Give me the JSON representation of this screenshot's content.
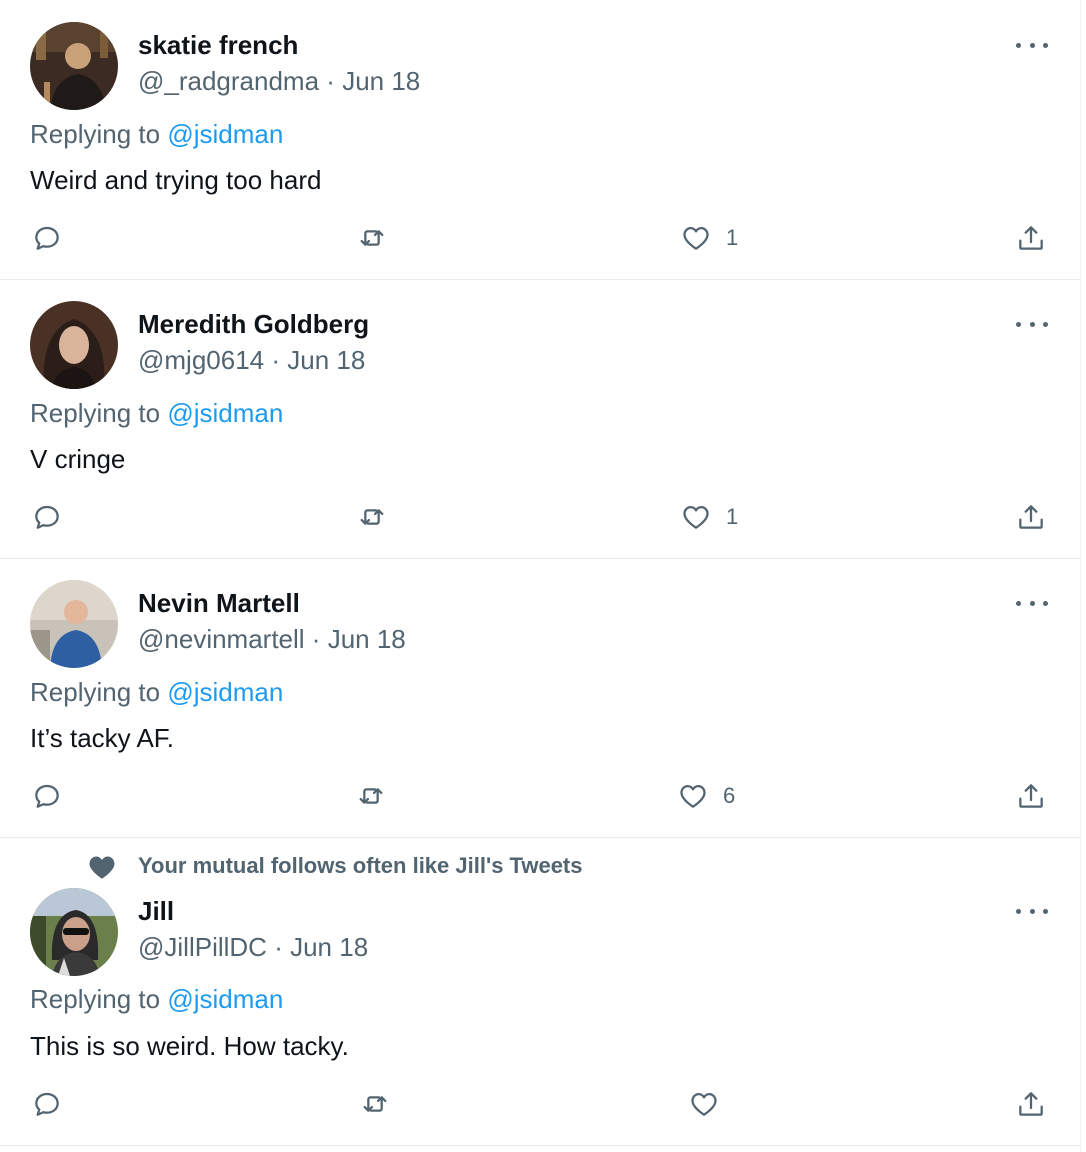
{
  "tweets": [
    {
      "name": "skatie french",
      "handle": "@_radgrandma",
      "date": "Jun 18",
      "replying_label": "Replying to",
      "replying_to": "@jsidman",
      "text": "Weird and trying too hard",
      "likes": "1",
      "avatar_colors": [
        "#3b2b22",
        "#c9a27a",
        "#1f1a17"
      ]
    },
    {
      "name": "Meredith Goldberg",
      "handle": "@mjg0614",
      "date": "Jun 18",
      "replying_label": "Replying to",
      "replying_to": "@jsidman",
      "text": "V cringe",
      "likes": "1",
      "avatar_colors": [
        "#2b1d17",
        "#d9b39a",
        "#4a3126"
      ]
    },
    {
      "name": "Nevin Martell",
      "handle": "@nevinmartell",
      "date": "Jun 18",
      "replying_label": "Replying to",
      "replying_to": "@jsidman",
      "text": "It’s tacky AF.",
      "likes": "6",
      "avatar_colors": [
        "#c8c2b8",
        "#2f5fa3",
        "#e2b79a"
      ]
    },
    {
      "social_context": "Your mutual follows often like Jill's Tweets",
      "name": "Jill",
      "handle": "@JillPillDC",
      "date": "Jun 18",
      "replying_label": "Replying to",
      "replying_to": "@jsidman",
      "text": "This is so weird. How tacky.",
      "likes": "",
      "avatar_colors": [
        "#6b7f4a",
        "#caa08a",
        "#2a2a2a"
      ]
    }
  ],
  "separator": "·",
  "colors": {
    "link": "#1d9bf0",
    "secondary_text": "#536471",
    "primary_text": "#0f1419",
    "divider": "#e6ecf0"
  }
}
